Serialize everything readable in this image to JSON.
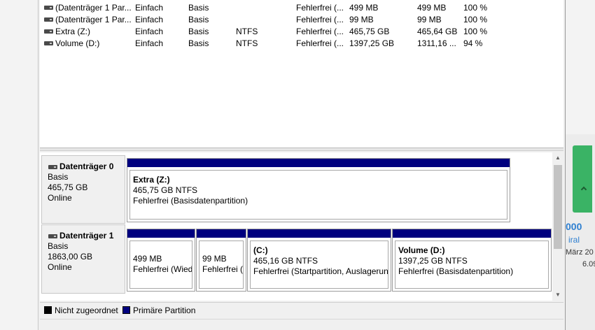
{
  "volumes": [
    {
      "name": "(Datenträger 1 Par...",
      "layout": "Einfach",
      "type": "Basis",
      "fs": "",
      "status": "Fehlerfrei (...",
      "capacity": "499 MB",
      "free": "499 MB",
      "pct": "100 %"
    },
    {
      "name": "(Datenträger 1 Par...",
      "layout": "Einfach",
      "type": "Basis",
      "fs": "",
      "status": "Fehlerfrei (...",
      "capacity": "99 MB",
      "free": "99 MB",
      "pct": "100 %"
    },
    {
      "name": "Extra (Z:)",
      "layout": "Einfach",
      "type": "Basis",
      "fs": "NTFS",
      "status": "Fehlerfrei (...",
      "capacity": "465,75 GB",
      "free": "465,64 GB",
      "pct": "100 %"
    },
    {
      "name": "Volume (D:)",
      "layout": "Einfach",
      "type": "Basis",
      "fs": "NTFS",
      "status": "Fehlerfrei (...",
      "capacity": "1397,25 GB",
      "free": "1311,16 ...",
      "pct": "94 %"
    }
  ],
  "disks": [
    {
      "name": "Datenträger 0",
      "type": "Basis",
      "size": "465,75 GB",
      "state": "Online",
      "partitions": [
        {
          "title": "Extra  (Z:)",
          "size_fs": "465,75 GB NTFS",
          "status": "Fehlerfrei (Basisdatenpartition)"
        }
      ]
    },
    {
      "name": "Datenträger 1",
      "type": "Basis",
      "size": "1863,00 GB",
      "state": "Online",
      "partitions": [
        {
          "title": "",
          "size_fs": "499 MB",
          "status": "Fehlerfrei (Wied"
        },
        {
          "title": "",
          "size_fs": "99 MB",
          "status": "Fehlerfrei ("
        },
        {
          "title": "(C:)",
          "size_fs": "465,16 GB NTFS",
          "status": "Fehlerfrei (Startpartition, Auslagerun"
        },
        {
          "title": "Volume  (D:)",
          "size_fs": "1397,25 GB NTFS",
          "status": "Fehlerfrei (Basisdatenpartition)"
        }
      ]
    }
  ],
  "legend": {
    "unallocated": "Nicht zugeordnet",
    "primary": "Primäre Partition",
    "unallocated_color": "#000000",
    "primary_color": "#00007f"
  },
  "background": {
    "tile_value": "000",
    "tile_sub": "iral",
    "date": "März 20",
    "time": "6.09"
  },
  "colors": {
    "partition_bar": "#00007f",
    "green_tile": "#3ab365",
    "tile_text": "#2e7fd0"
  }
}
